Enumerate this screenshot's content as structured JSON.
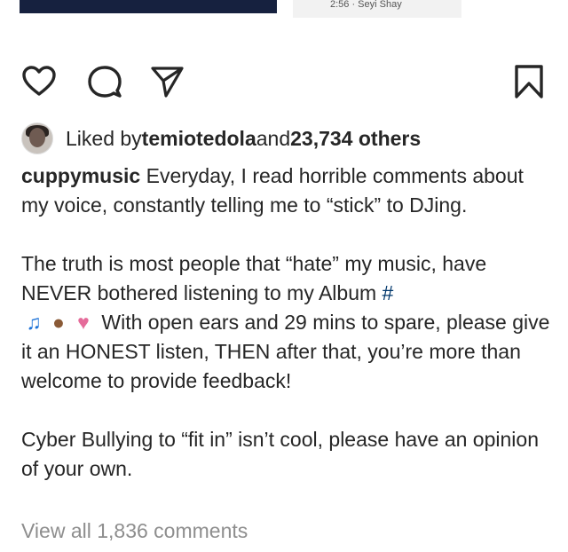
{
  "media": {
    "caption": "2:56 · Seyi Shay"
  },
  "actions": {
    "like_icon": "heart-icon",
    "comment_icon": "comment-bubble-icon",
    "share_icon": "paper-plane-icon",
    "save_icon": "bookmark-icon"
  },
  "likes": {
    "prefix": "Liked by ",
    "user": "temiotedola",
    "middle": " and ",
    "count": "23,734 others"
  },
  "caption": {
    "author": "cuppymusic",
    "p1": " Everyday, I read horrible comments about my voice, constantly telling me to “stick” to DJing.",
    "p2_line1": "The truth is most people that “hate” my music, have",
    "p2_line2": "NEVER bothered listening to my Album ",
    "hashtag": "#",
    "emoji_note": "♫",
    "emoji_ear": "●",
    "emoji_cake": "♥",
    "p2_rest": " With open ears and 29 mins to spare, please give it an HONEST listen, THEN after that, you’re more than welcome to provide feedback!",
    "p3": "Cyber Bullying to “fit in” isn’t cool, please have an opinion of your own."
  },
  "comments": {
    "view_all": "View all 1,836 comments"
  }
}
